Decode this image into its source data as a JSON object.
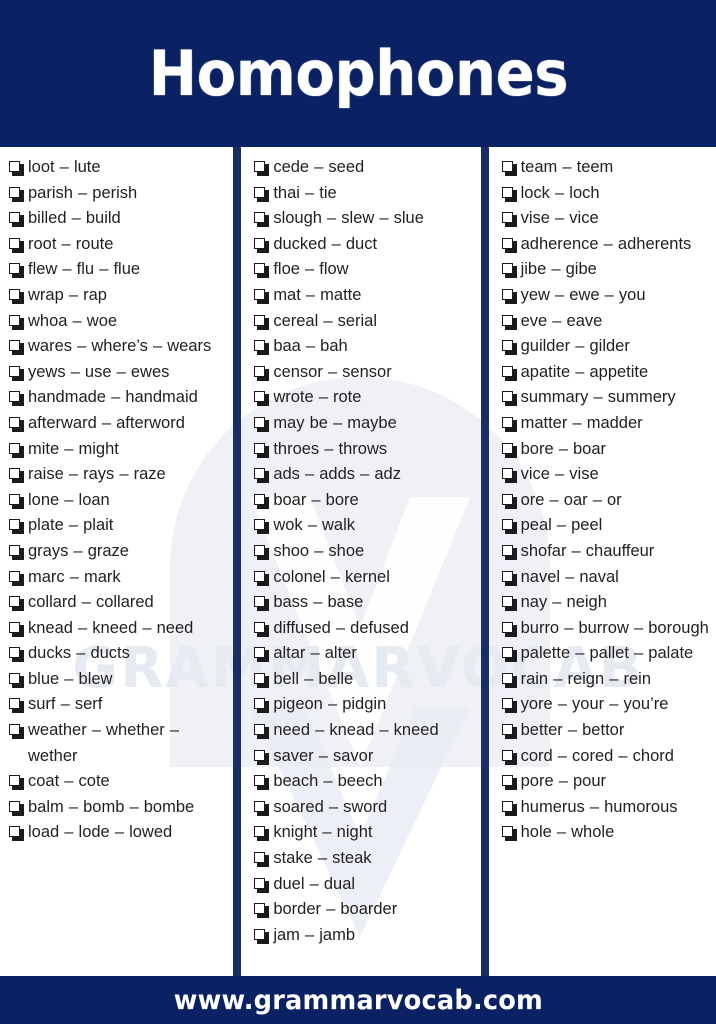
{
  "header": {
    "title": "Homophones",
    "background_color": "#0a2263",
    "text_color": "#ffffff"
  },
  "footer": {
    "url": "www.grammarvocab.com",
    "background_color": "#0a2263",
    "text_color": "#ffffff"
  },
  "watermark": {
    "text": "GRAMMARVOCAB",
    "color": "#e9ecf3"
  },
  "divider_color": "#1a2e66",
  "checkbox_icon": "checkbox-empty-icon",
  "columns": [
    {
      "items": [
        "loot – lute",
        "parish – perish",
        "billed – build",
        "root – route",
        "flew – flu – flue",
        "wrap – rap",
        "whoa – woe",
        "wares – where’s – wears",
        "yews – use – ewes",
        "handmade – handmaid",
        "afterward – afterword",
        "mite – might",
        "raise – rays – raze",
        "lone – loan",
        "plate – plait",
        "grays – graze",
        "marc – mark",
        "collard – collared",
        "knead – kneed – need",
        "ducks – ducts",
        "blue – blew",
        "surf – serf",
        "weather – whether – wether",
        "coat – cote",
        "balm – bomb – bombe",
        "load – lode – lowed"
      ]
    },
    {
      "items": [
        "cede – seed",
        "thai – tie",
        "slough – slew – slue",
        "ducked – duct",
        "floe – flow",
        "mat – matte",
        "cereal – serial",
        "baa – bah",
        "censor – sensor",
        "wrote – rote",
        "may be – maybe",
        "throes – throws",
        "ads – adds – adz",
        "boar – bore",
        "wok – walk",
        "shoo – shoe",
        "colonel – kernel",
        "bass – base",
        "diffused – defused",
        "altar – alter",
        "bell – belle",
        "pigeon – pidgin",
        "need – knead – kneed",
        "saver – savor",
        "beach – beech",
        "soared – sword",
        "knight – night",
        "stake – steak",
        "duel – dual",
        "border – boarder",
        "jam – jamb"
      ]
    },
    {
      "items": [
        "team – teem",
        "lock – loch",
        "vise – vice",
        "adherence – adherents",
        "jibe – gibe",
        "yew – ewe – you",
        "eve – eave",
        "guilder – gilder",
        "apatite – appetite",
        "summary – summery",
        "matter – madder",
        "bore – boar",
        "vice – vise",
        "ore – oar – or",
        "peal – peel",
        "shofar – chauffeur",
        "navel – naval",
        "nay – neigh",
        "burro – burrow – borough",
        "palette – pallet – palate",
        "rain – reign – rein",
        "yore – your – you’re",
        "better – bettor",
        "cord – cored – chord",
        "pore – pour",
        "humerus – humorous",
        "hole – whole"
      ]
    }
  ]
}
